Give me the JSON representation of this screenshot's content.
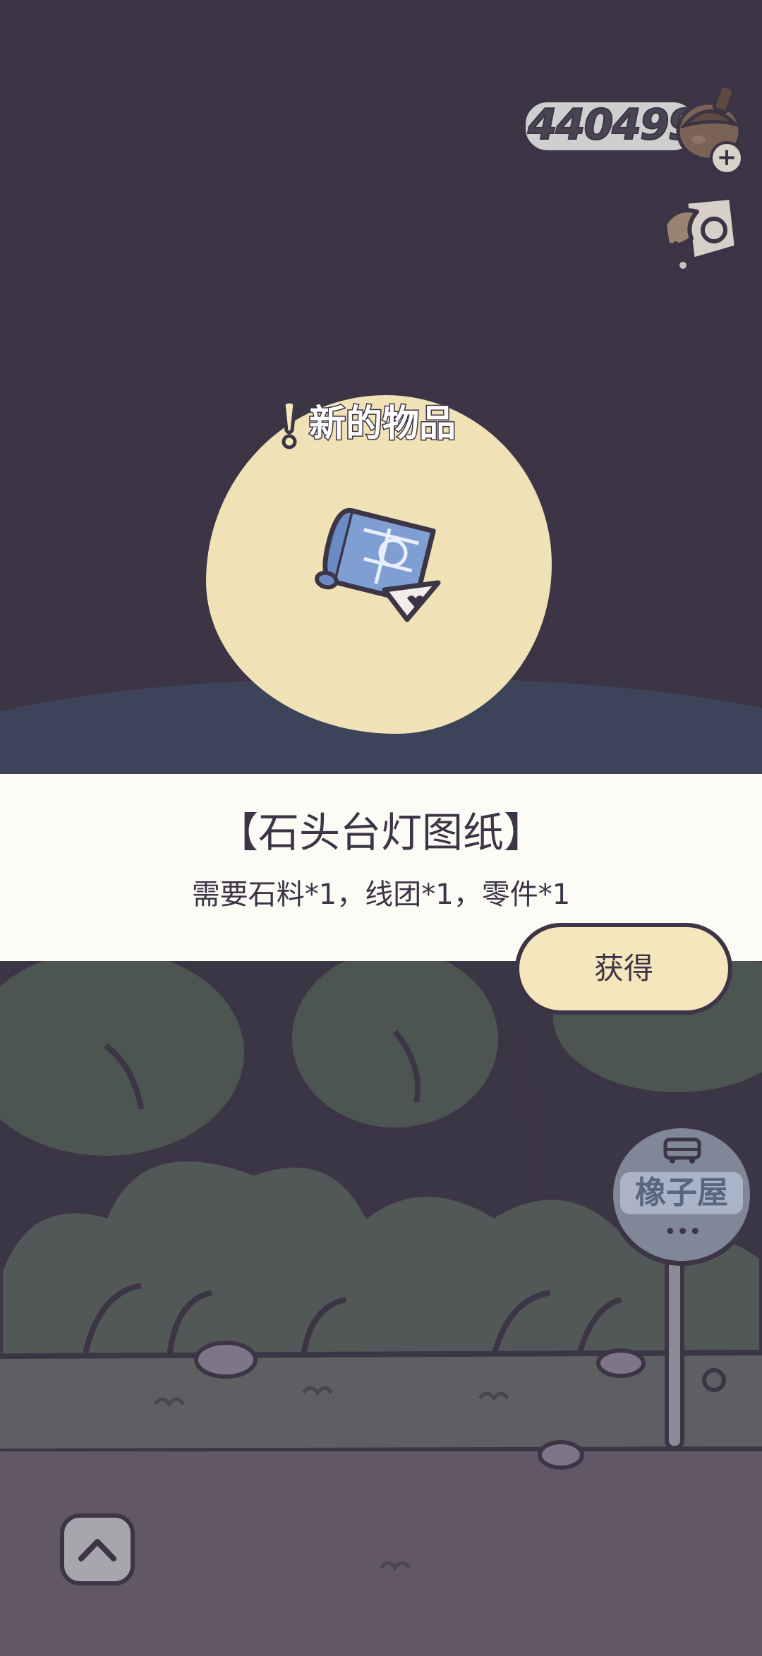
{
  "currency": {
    "amount": "440499",
    "add_icon": "plus-icon",
    "coin_icon": "acorn-coin-icon"
  },
  "top_right": {
    "map_icon": "bus-map-icon"
  },
  "popup": {
    "badge_icon": "exclamation-icon",
    "new_item_label": "新的物品",
    "item_icon": "blueprint-scroll-icon",
    "item_title": "【石头台灯图纸】",
    "item_requirement": "需要石料*1，线团*1，零件*1",
    "get_button_label": "获得"
  },
  "scene": {
    "bus_stop_sign": "橡子屋",
    "bus_icon": "bus-icon",
    "expand_icon": "chevron-up-icon"
  },
  "colors": {
    "night_bg": "#3b3546",
    "blob": "#f0e1b6",
    "panel": "#fdfbf6",
    "button": "#f5e6be",
    "outline": "#3b3546"
  }
}
